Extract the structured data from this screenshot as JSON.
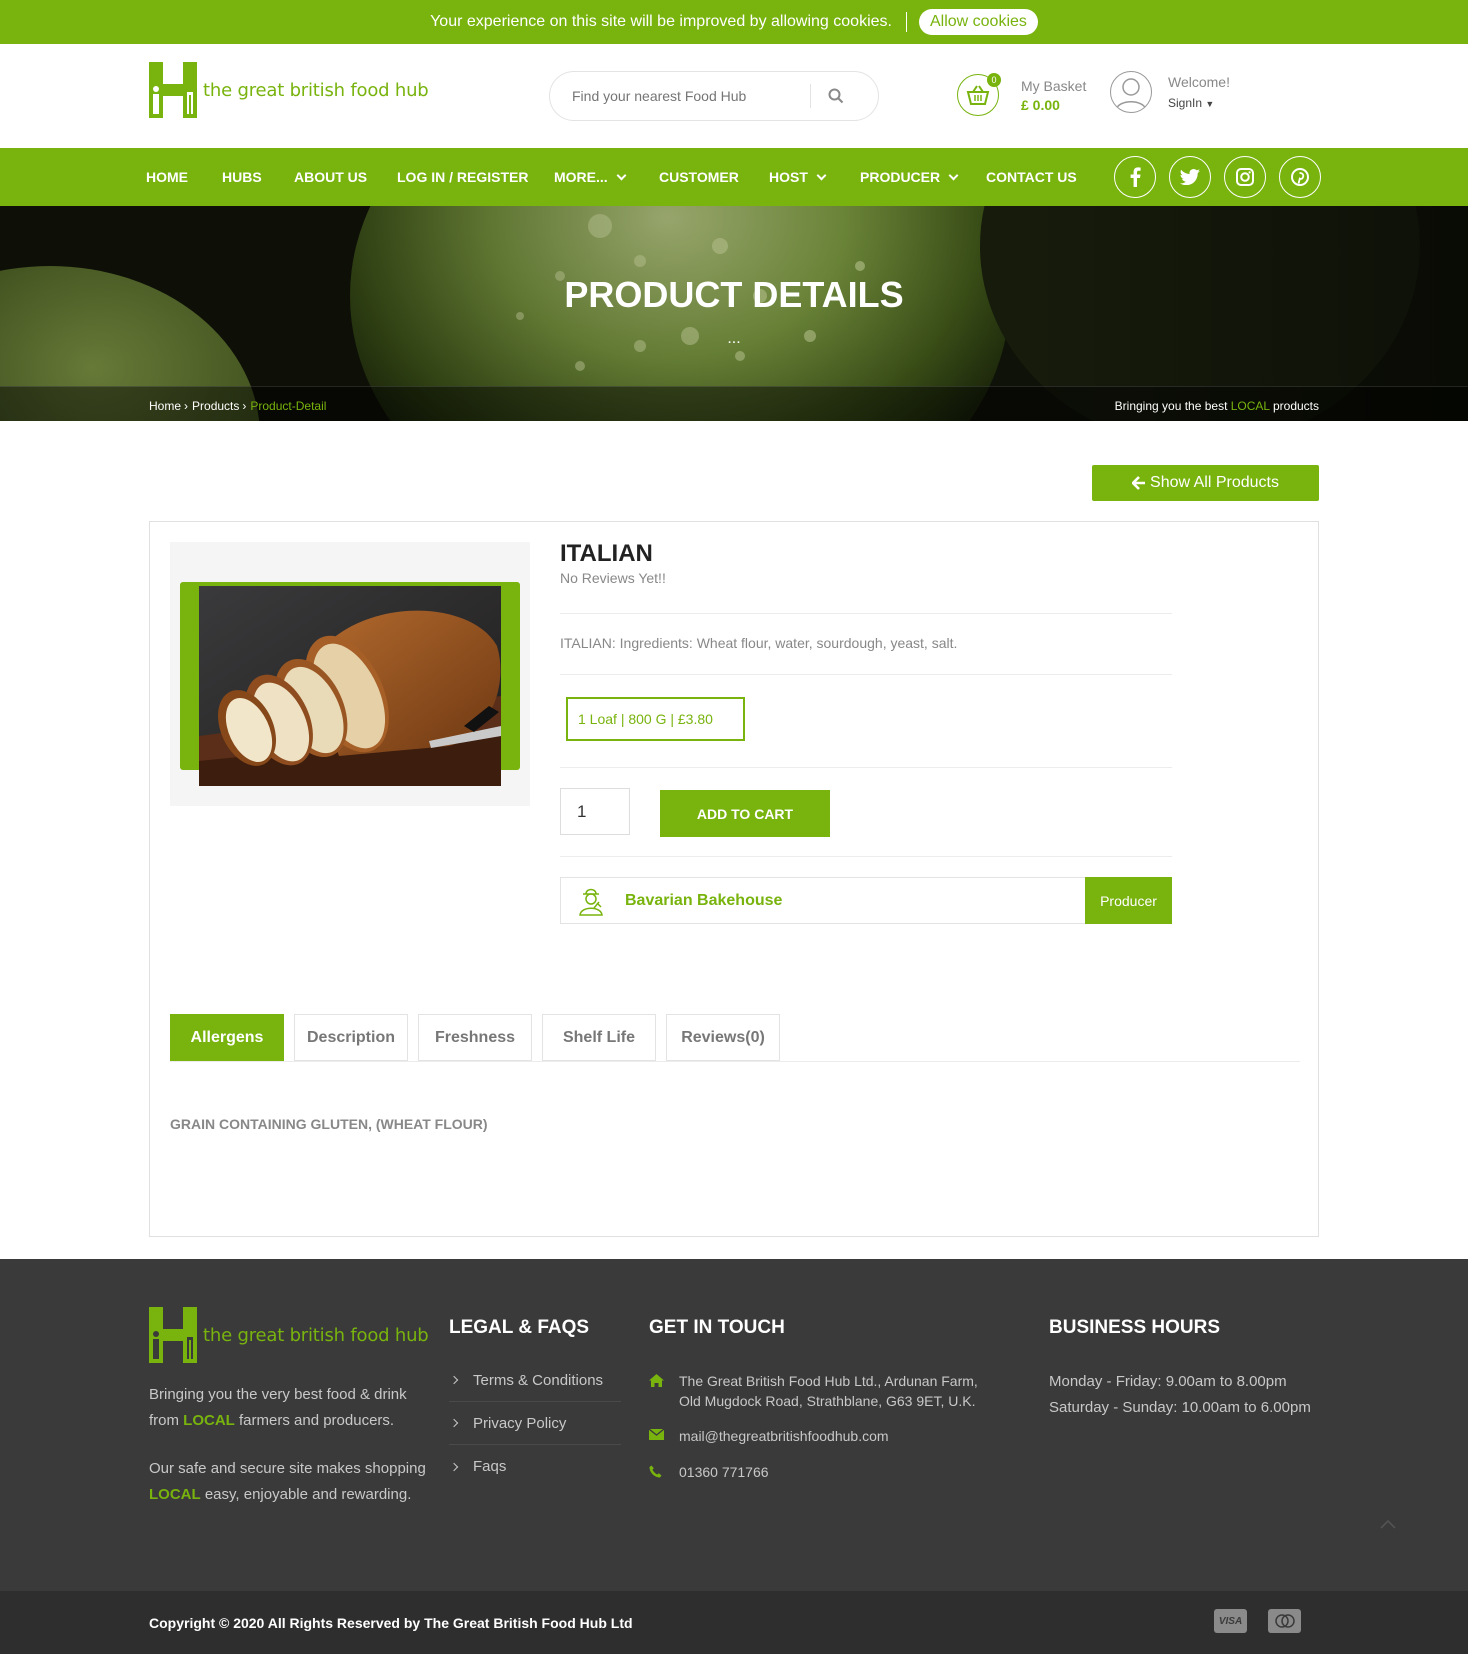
{
  "cookie": {
    "message": "Your experience on this site will be improved by allowing cookies.",
    "button": "Allow cookies"
  },
  "header": {
    "logo_text": "the great british food hub",
    "search_placeholder": "Find your nearest Food Hub",
    "basket_label": "My Basket",
    "basket_amount": "£ 0.00",
    "basket_count": "0",
    "welcome": "Welcome!",
    "signin": "SignIn"
  },
  "nav": {
    "items": [
      "HOME",
      "HUBS",
      "ABOUT US",
      "LOG IN / REGISTER",
      "MORE...",
      "CUSTOMER",
      "HOST",
      "PRODUCER",
      "CONTACT US"
    ],
    "social": [
      "facebook-icon",
      "twitter-icon",
      "instagram-icon",
      "pinterest-icon"
    ]
  },
  "banner": {
    "title": "PRODUCT DETAILS",
    "dots": "...",
    "breadcrumb": [
      "Home",
      "Products",
      "Product-Detail"
    ],
    "tagline_pre": "Bringing you the best ",
    "tagline_local": "LOCAL",
    "tagline_post": " products"
  },
  "product": {
    "show_all": "Show All Products",
    "name": "ITALIAN",
    "reviews": "No Reviews Yet!!",
    "ingredients": "ITALIAN: Ingredients: Wheat flour, water, sourdough, yeast, salt.",
    "variant": "1 Loaf |  800 G |  £3.80",
    "quantity": "1",
    "add_to_cart": "ADD TO CART",
    "producer_name": "Bavarian Bakehouse",
    "producer_tag": "Producer"
  },
  "tabs": {
    "items": [
      "Allergens",
      "Description",
      "Freshness",
      "Shelf Life",
      "Reviews(0)"
    ],
    "active_index": 0,
    "content": "GRAIN CONTAINING GLUTEN, (WHEAT FLOUR)"
  },
  "footer": {
    "logo_text": "the great british food hub",
    "about_1_pre": "Bringing you the very best food & drink from ",
    "about_1_local": "LOCAL",
    "about_1_post": " farmers and producers.",
    "about_2_pre": "Our safe and secure site makes shopping ",
    "about_2_local": "LOCAL",
    "about_2_post": " easy, enjoyable and rewarding.",
    "legal_heading": "LEGAL & FAQS",
    "legal_links": [
      "Terms & Conditions",
      "Privacy Policy",
      "Faqs"
    ],
    "contact_heading": "GET IN TOUCH",
    "address": "The Great British Food Hub Ltd., Ardunan Farm, Old Mugdock Road, Strathblane, G63 9ET, U.K.",
    "email": "mail@thegreatbritishfoodhub.com",
    "phone": "01360 771766",
    "hours_heading": "BUSINESS HOURS",
    "hours": [
      "Monday - Friday: 9.00am to 8.00pm",
      "Saturday - Sunday: 10.00am to 6.00pm"
    ],
    "copyright": "Copyright © 2020 All Rights Reserved by The Great British Food Hub Ltd",
    "payments": [
      "VISA",
      "MasterCard"
    ]
  },
  "colors": {
    "brand_green": "#78b30e",
    "footer_bg": "#3a3a3a",
    "copyright_bg": "#2e2e2e"
  }
}
